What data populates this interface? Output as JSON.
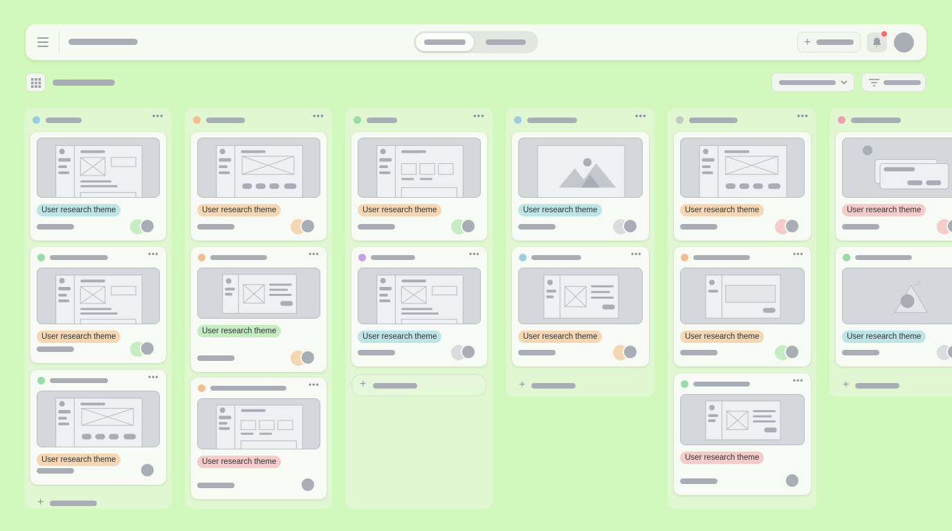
{
  "board": {
    "tag_text": "User research theme",
    "colors": {
      "blue": "#bfe4e6",
      "orange": "#f6d7b3",
      "green": "#c6edc1",
      "pink": "#f6cccb",
      "dot_blue": "#9ccde0",
      "dot_orange": "#f2be96",
      "dot_green": "#99dca6",
      "dot_purple": "#c9a0e8",
      "dot_pink": "#ef9fb3",
      "dot_gray": "#c2cac2"
    }
  },
  "icons": {
    "menu": "hamburger-icon",
    "bell": "bell-icon",
    "grid": "grid-view-icon",
    "chevron": "chevron-down-icon",
    "filter": "filter-icon",
    "plus": "plus-icon",
    "more": "more-horizontal-icon"
  },
  "glyphs": {
    "plus": "+",
    "more": "•••"
  }
}
